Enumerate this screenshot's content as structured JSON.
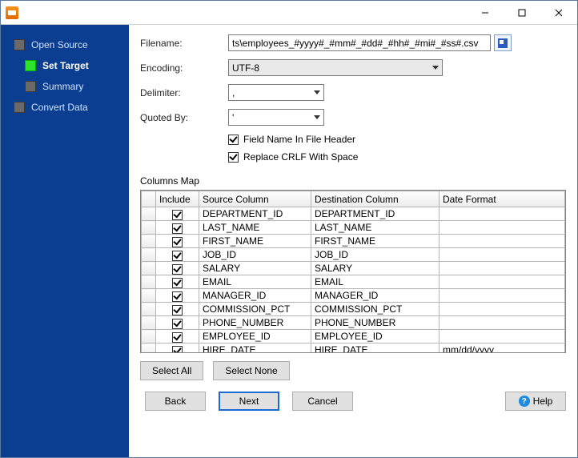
{
  "sidebar": {
    "items": [
      {
        "label": "Open Source"
      },
      {
        "label": "Set Target"
      },
      {
        "label": "Summary"
      },
      {
        "label": "Convert Data"
      }
    ]
  },
  "form": {
    "filename_label": "Filename:",
    "filename_value": "ts\\employees_#yyyy#_#mm#_#dd#_#hh#_#mi#_#ss#.csv",
    "encoding_label": "Encoding:",
    "encoding_value": "UTF-8",
    "delimiter_label": "Delimiter:",
    "delimiter_value": ",",
    "quoted_label": "Quoted By:",
    "quoted_value": "'",
    "fieldname_label": "Field Name In File Header",
    "replacecrlf_label": "Replace CRLF With Space"
  },
  "columns": {
    "section_label": "Columns Map",
    "headers": {
      "include": "Include",
      "source": "Source Column",
      "dest": "Destination Column",
      "datefmt": "Date Format"
    },
    "rows": [
      {
        "src": "DEPARTMENT_ID",
        "dst": "DEPARTMENT_ID",
        "fmt": ""
      },
      {
        "src": "LAST_NAME",
        "dst": "LAST_NAME",
        "fmt": ""
      },
      {
        "src": "FIRST_NAME",
        "dst": "FIRST_NAME",
        "fmt": ""
      },
      {
        "src": "JOB_ID",
        "dst": "JOB_ID",
        "fmt": ""
      },
      {
        "src": "SALARY",
        "dst": "SALARY",
        "fmt": ""
      },
      {
        "src": "EMAIL",
        "dst": "EMAIL",
        "fmt": ""
      },
      {
        "src": "MANAGER_ID",
        "dst": "MANAGER_ID",
        "fmt": ""
      },
      {
        "src": "COMMISSION_PCT",
        "dst": "COMMISSION_PCT",
        "fmt": ""
      },
      {
        "src": "PHONE_NUMBER",
        "dst": "PHONE_NUMBER",
        "fmt": ""
      },
      {
        "src": "EMPLOYEE_ID",
        "dst": "EMPLOYEE_ID",
        "fmt": ""
      },
      {
        "src": "HIRE_DATE",
        "dst": "HIRE_DATE",
        "fmt": "mm/dd/yyyy"
      }
    ]
  },
  "buttons": {
    "select_all": "Select All",
    "select_none": "Select None",
    "back": "Back",
    "next": "Next",
    "cancel": "Cancel",
    "help": "Help"
  }
}
